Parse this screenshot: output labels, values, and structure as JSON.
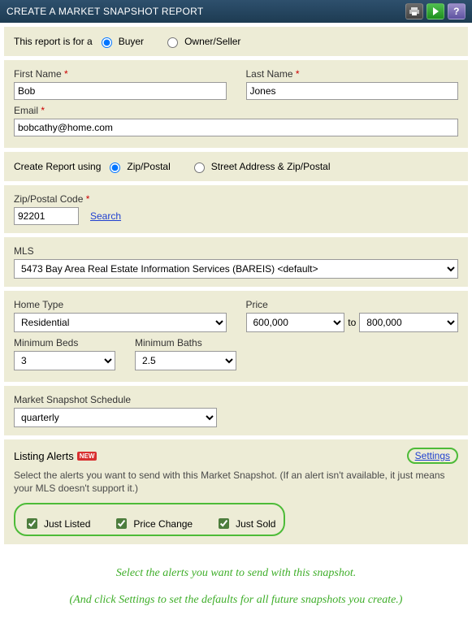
{
  "titlebar": {
    "title": "CREATE A MARKET SNAPSHOT REPORT"
  },
  "report_for": {
    "label": "This report is for a",
    "options": {
      "buyer": "Buyer",
      "owner": "Owner/Seller"
    },
    "selected": "buyer"
  },
  "first_name": {
    "label": "First Name",
    "value": "Bob"
  },
  "last_name": {
    "label": "Last Name",
    "value": "Jones"
  },
  "email": {
    "label": "Email",
    "value": "bobcathy@home.com"
  },
  "create_using": {
    "label": "Create Report using",
    "options": {
      "zip": "Zip/Postal",
      "addr": "Street Address & Zip/Postal"
    },
    "selected": "zip"
  },
  "zip": {
    "label": "Zip/Postal Code",
    "value": "92201",
    "search": "Search"
  },
  "mls": {
    "label": "MLS",
    "value": "5473 Bay Area Real Estate Information Services (BAREIS) <default>"
  },
  "home_type": {
    "label": "Home Type",
    "value": "Residential"
  },
  "price": {
    "label": "Price",
    "from": "600,000",
    "to_label": "to",
    "to": "800,000"
  },
  "min_beds": {
    "label": "Minimum Beds",
    "value": "3"
  },
  "min_baths": {
    "label": "Minimum Baths",
    "value": "2.5"
  },
  "schedule": {
    "label": "Market Snapshot Schedule",
    "value": "quarterly"
  },
  "alerts": {
    "heading": "Listing Alerts",
    "new_badge": "NEW",
    "settings": "Settings",
    "help": "Select the alerts you want to send with this Market Snapshot. (If an alert isn't available, it just means your MLS doesn't support it.)",
    "just_listed": "Just Listed",
    "price_change": "Price Change",
    "just_sold": "Just Sold"
  },
  "annotation": {
    "line1": "Select the alerts you want to send with this snapshot.",
    "line2": "(And click Settings to set the defaults for all future snapshots you create.)"
  }
}
